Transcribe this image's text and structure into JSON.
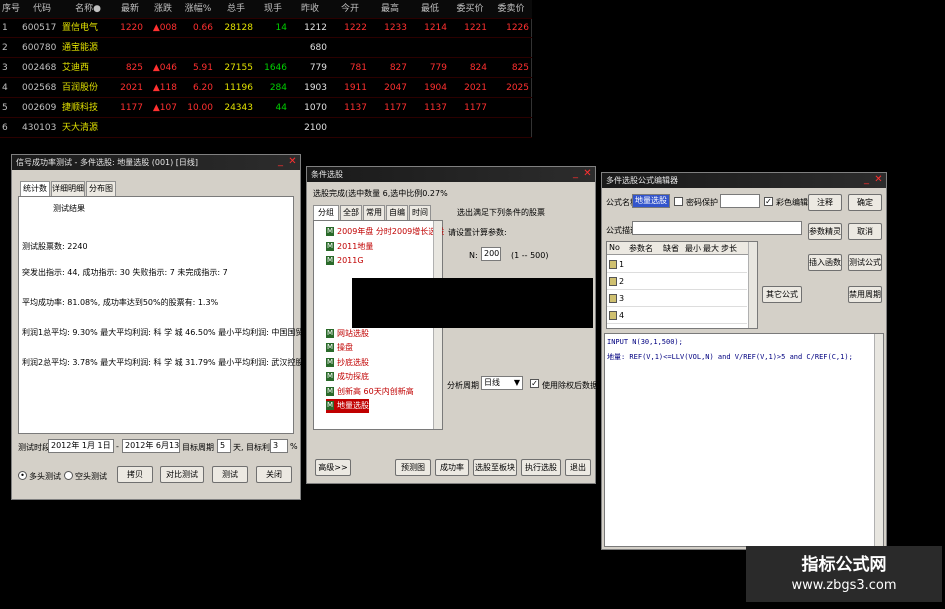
{
  "grid": {
    "headers": [
      "序号",
      "代码",
      "名称●",
      "最新",
      "涨跌",
      "涨幅%",
      "总手",
      "现手",
      "昨收",
      "今开",
      "最高",
      "最低",
      "委买价",
      "委卖价"
    ],
    "rows": [
      {
        "no": "1",
        "code": "600517",
        "name": "置信电气",
        "last": "1220",
        "chg": "▲008",
        "pct": "0.66",
        "vol": "28128",
        "cur": "14",
        "prev": "1212",
        "open": "1222",
        "high": "1233",
        "low": "1214",
        "bid": "1221",
        "ask": "1226"
      },
      {
        "no": "2",
        "code": "600780",
        "name": "通宝能源",
        "last": "",
        "chg": "",
        "pct": "",
        "vol": "",
        "cur": "",
        "prev": "680",
        "open": "",
        "high": "",
        "low": "",
        "bid": "",
        "ask": ""
      },
      {
        "no": "3",
        "code": "002468",
        "name": "艾迪西",
        "last": "825",
        "chg": "▲046",
        "pct": "5.91",
        "vol": "27155",
        "cur": "1646",
        "prev": "779",
        "open": "781",
        "high": "827",
        "low": "779",
        "bid": "824",
        "ask": "825"
      },
      {
        "no": "4",
        "code": "002568",
        "name": "百润股份",
        "last": "2021",
        "chg": "▲118",
        "pct": "6.20",
        "vol": "11196",
        "cur": "284",
        "prev": "1903",
        "open": "1911",
        "high": "2047",
        "low": "1904",
        "bid": "2021",
        "ask": "2025"
      },
      {
        "no": "5",
        "code": "002609",
        "name": "捷顺科技",
        "last": "1177",
        "chg": "▲107",
        "pct": "10.00",
        "vol": "24343",
        "cur": "44",
        "prev": "1070",
        "open": "1137",
        "high": "1177",
        "low": "1137",
        "bid": "1177",
        "ask": ""
      },
      {
        "no": "6",
        "code": "430103",
        "name": "天大清源",
        "last": "",
        "chg": "",
        "pct": "",
        "vol": "",
        "cur": "",
        "prev": "2100",
        "open": "",
        "high": "",
        "low": "",
        "bid": "",
        "ask": ""
      }
    ]
  },
  "win1": {
    "title": "信号成功率测试 - 多件选股: 地量选股 (001) [日线]",
    "tabs": [
      "统计数据",
      "详细明细",
      "分布图"
    ],
    "heading": "测试结果",
    "lines": [
      "测试股票数: 2240",
      "突发出指示: 44, 成功指示: 30 失败指示: 7 未完成指示: 7",
      "平均成功率: 81.08%, 成功率达到50%的股票有: 1.3%",
      "利润1总平均: 9.30% 最大平均利润: 科 学 城 46.50% 最小平均利润: 中国国贸 0.00%",
      "利润2总平均: 3.78% 最大平均利润: 科 学 城 31.79% 最小平均利润: 武汉控股 -14.70%"
    ],
    "period_label": "测试时段",
    "date_from": "2012年 1月 1日",
    "date_to": "2012年 6月13日",
    "target_period_label": "目标周期",
    "target_period": "5",
    "days_label": "天,",
    "target_profit_label": "目标利润",
    "target_profit": "3",
    "pct_sign": "%",
    "radio_long": "多头测试",
    "radio_short": "空头测试",
    "btn_copy": "拷贝",
    "btn_compare": "对比测试",
    "btn_test": "测试",
    "btn_close": "关闭"
  },
  "win2": {
    "title": "条件选股",
    "summary": "选股完成(选中数量 6,选中比例0.27%",
    "tabs": [
      "分组",
      "全部",
      "常用",
      "自编",
      "时间"
    ],
    "tree": [
      "2009年盘 分时2009增长选股",
      "2011地量",
      "2011G",
      "",
      "",
      "",
      "",
      "网站选股",
      "操盘",
      "抄底选股",
      "成功探底",
      "创新高 60天内创新高",
      "地量选股"
    ],
    "selected_item": "地量选股",
    "section_title": "选出满足下列条件的股票",
    "params_label": "请设置计算参数:",
    "param_name": "N:",
    "param_value": "200",
    "param_range": "(1 -- 500)",
    "period_label": "分析周期",
    "period_value": "日线",
    "use_rights_label": "使用除权后数据",
    "btn_advanced": "高级>>",
    "btn_preview": "预测图",
    "btn_success": "成功率",
    "btn_to_block": "选股至板块",
    "btn_execute": "执行选股",
    "btn_exit": "退出"
  },
  "win3": {
    "title": "多件选股公式编辑器",
    "name_label": "公式名称",
    "name_value": "地量选股",
    "password_label": "密码保护",
    "color_label": "彩色编辑",
    "desc_label": "公式描述",
    "table_headers": [
      "No",
      "参数名",
      "缺省",
      "最小",
      "最大",
      "步长"
    ],
    "table_rows": [
      "1",
      "2",
      "3",
      "4"
    ],
    "btn_confirm": "确定",
    "btn_cancel": "取消",
    "btn_insert_fn": "插入函数",
    "btn_test_formula": "测试公式",
    "btn_other": "其它公式",
    "btn_params": "参数精灵",
    "btn_translate": "注释",
    "btn_period": "禁用周期",
    "code_line1": "INPUT N(30,1,500);",
    "code_line2": "地量: REF(V,1)<=LLV(VOL,N) and V/REF(V,1)>5 and C/REF(C,1);"
  },
  "watermark": {
    "title": "指标公式网",
    "url": "www.zbgs3.com"
  },
  "colors": {
    "up": "#ff3030",
    "name": "#e0e000",
    "flat": "#e0e0e0",
    "vol": "#00d000"
  }
}
